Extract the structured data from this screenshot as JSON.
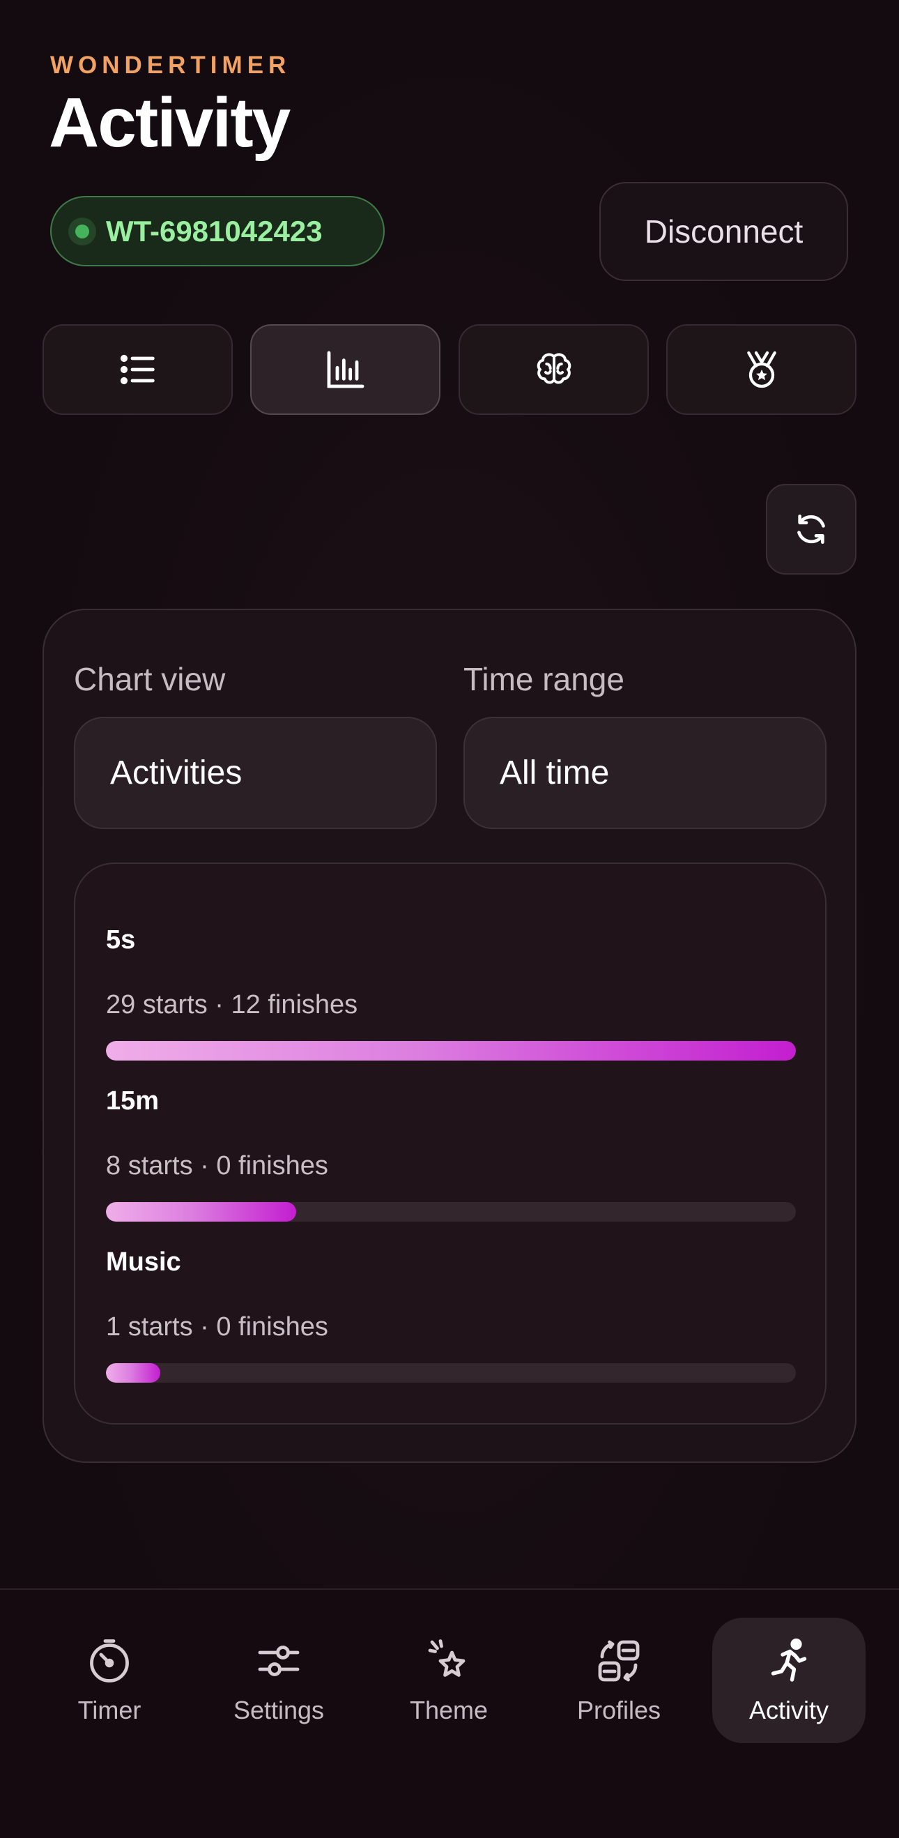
{
  "app": {
    "brand": "WONDERTIMER",
    "page_title": "Activity"
  },
  "device": {
    "id": "WT-6981042423",
    "status_color": "#45b35a"
  },
  "header": {
    "disconnect_label": "Disconnect"
  },
  "tabs": [
    {
      "icon": "list-icon",
      "active": false
    },
    {
      "icon": "bar-chart-icon",
      "active": true
    },
    {
      "icon": "brain-icon",
      "active": false
    },
    {
      "icon": "medal-icon",
      "active": false
    }
  ],
  "refresh": {
    "icon": "refresh-icon"
  },
  "controls": {
    "chart_view_label": "Chart view",
    "chart_view_value": "Activities",
    "time_range_label": "Time range",
    "time_range_value": "All time"
  },
  "activities": [
    {
      "name": "5s",
      "stats": "29 starts · 12 finishes",
      "starts": 29
    },
    {
      "name": "15m",
      "stats": "8 starts · 0 finishes",
      "starts": 8
    },
    {
      "name": "Music",
      "stats": "1 starts · 0 finishes",
      "starts": 1
    }
  ],
  "nav": {
    "items": [
      {
        "label": "Timer",
        "icon": "timer-icon"
      },
      {
        "label": "Settings",
        "icon": "sliders-icon"
      },
      {
        "label": "Theme",
        "icon": "sparkle-star-icon"
      },
      {
        "label": "Profiles",
        "icon": "profiles-icon"
      },
      {
        "label": "Activity",
        "icon": "running-person-icon"
      }
    ],
    "active": "Activity"
  },
  "colors": {
    "accent_orange": "#f2a262",
    "connected_green": "#9af0a0",
    "bar_gradient_start": "#f0aee9",
    "bar_gradient_end": "#c31ed0",
    "background": "#130b10"
  }
}
